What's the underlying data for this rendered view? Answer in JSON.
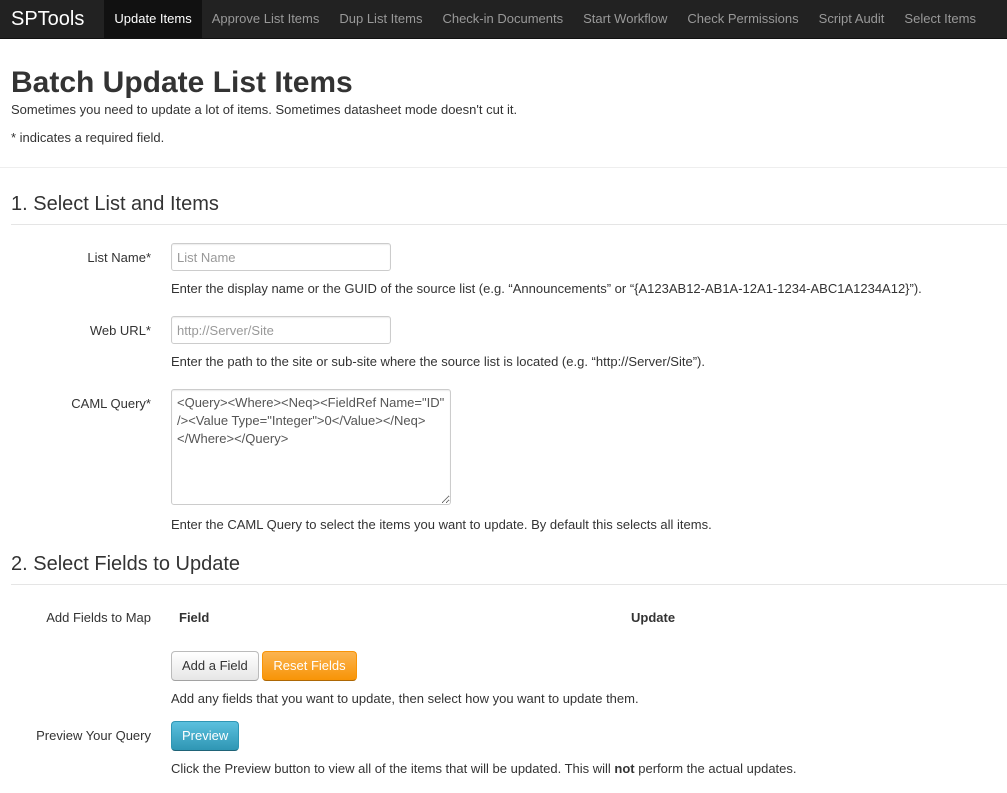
{
  "nav": {
    "brand": "SPTools",
    "items": [
      {
        "label": "Update Items",
        "active": true
      },
      {
        "label": "Approve List Items"
      },
      {
        "label": "Dup List Items"
      },
      {
        "label": "Check-in Documents"
      },
      {
        "label": "Start Workflow"
      },
      {
        "label": "Check Permissions"
      },
      {
        "label": "Script Audit"
      },
      {
        "label": "Select Items"
      }
    ]
  },
  "page": {
    "title": "Batch Update List Items",
    "lead": "Sometimes you need to update a lot of items. Sometimes datasheet mode doesn't cut it.",
    "required_note": "* indicates a required field."
  },
  "section1": {
    "legend": "1. Select List and Items",
    "list_name": {
      "label": "List Name*",
      "placeholder": "List Name",
      "value": "",
      "help": "Enter the display name or the GUID of the source list (e.g. “Announcements” or “{A123AB12-AB1A-12A1-1234-ABC1A1234A12}”)."
    },
    "web_url": {
      "label": "Web URL*",
      "placeholder": "http://Server/Site",
      "value": "",
      "help": "Enter the path to the site or sub-site where the source list is located (e.g. “http://Server/Site”)."
    },
    "caml": {
      "label": "CAML Query*",
      "value": "<Query><Where><Neq><FieldRef Name=\"ID\" /><Value Type=\"Integer\">0</Value></Neq></Where></Query>",
      "help": "Enter the CAML Query to select the items you want to update. By default this selects all items."
    }
  },
  "section2": {
    "legend": "2. Select Fields to Update",
    "map_label": "Add Fields to Map",
    "col_field": "Field",
    "col_update": "Update",
    "add_field_btn": "Add a Field",
    "reset_fields_btn": "Reset Fields",
    "map_help": "Add any fields that you want to update, then select how you want to update them.",
    "preview_label": "Preview Your Query",
    "preview_btn": "Preview",
    "preview_help_before": "Click the Preview button to view all of the items that will be updated. This will ",
    "preview_help_bold": "not",
    "preview_help_after": " perform the actual updates."
  },
  "colors": {
    "navbar": "#222222",
    "warning": "#f89406",
    "info": "#2f96b4"
  }
}
